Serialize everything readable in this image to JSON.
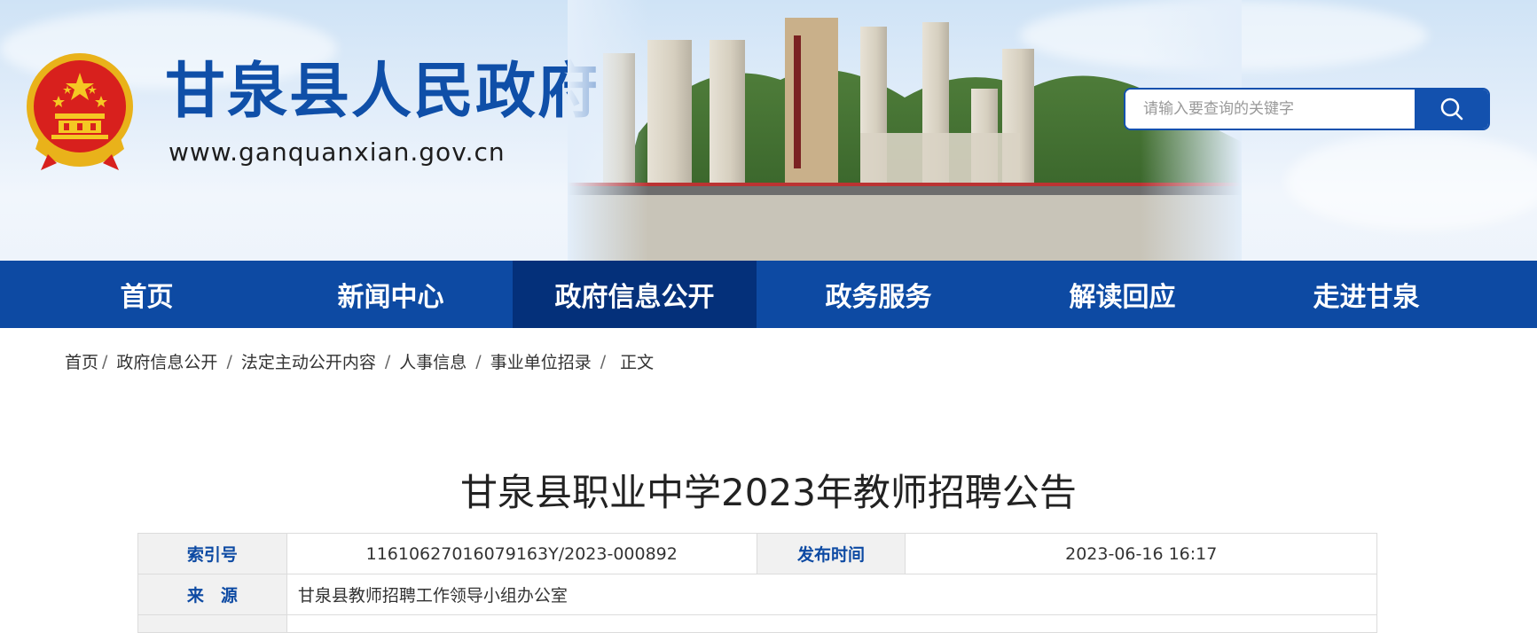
{
  "header": {
    "site_title": "甘泉县人民政府",
    "site_url": "www.ganquanxian.gov.cn",
    "brand_color": "#0f4fa8"
  },
  "search": {
    "placeholder": "请输入要查询的关键字",
    "icon": "search-icon"
  },
  "nav": {
    "items": [
      {
        "label": "首页",
        "active": false
      },
      {
        "label": "新闻中心",
        "active": false
      },
      {
        "label": "政府信息公开",
        "active": true
      },
      {
        "label": "政务服务",
        "active": false
      },
      {
        "label": "解读回应",
        "active": false
      },
      {
        "label": "走进甘泉",
        "active": false
      }
    ],
    "bg_color": "#0d4aa3",
    "active_color": "#04307a"
  },
  "breadcrumb": {
    "items": [
      "首页",
      "政府信息公开",
      "法定主动公开内容",
      "人事信息",
      "事业单位招录",
      "正文"
    ]
  },
  "article": {
    "title": "甘泉县职业中学2023年教师招聘公告",
    "meta": {
      "index_label": "索引号",
      "index_value": "11610627016079163Y/2023-000892",
      "date_label": "发布时间",
      "date_value": "2023-06-16 16:17",
      "source_label": "来　源",
      "source_value": "甘泉县教师招聘工作领导小组办公室"
    }
  }
}
